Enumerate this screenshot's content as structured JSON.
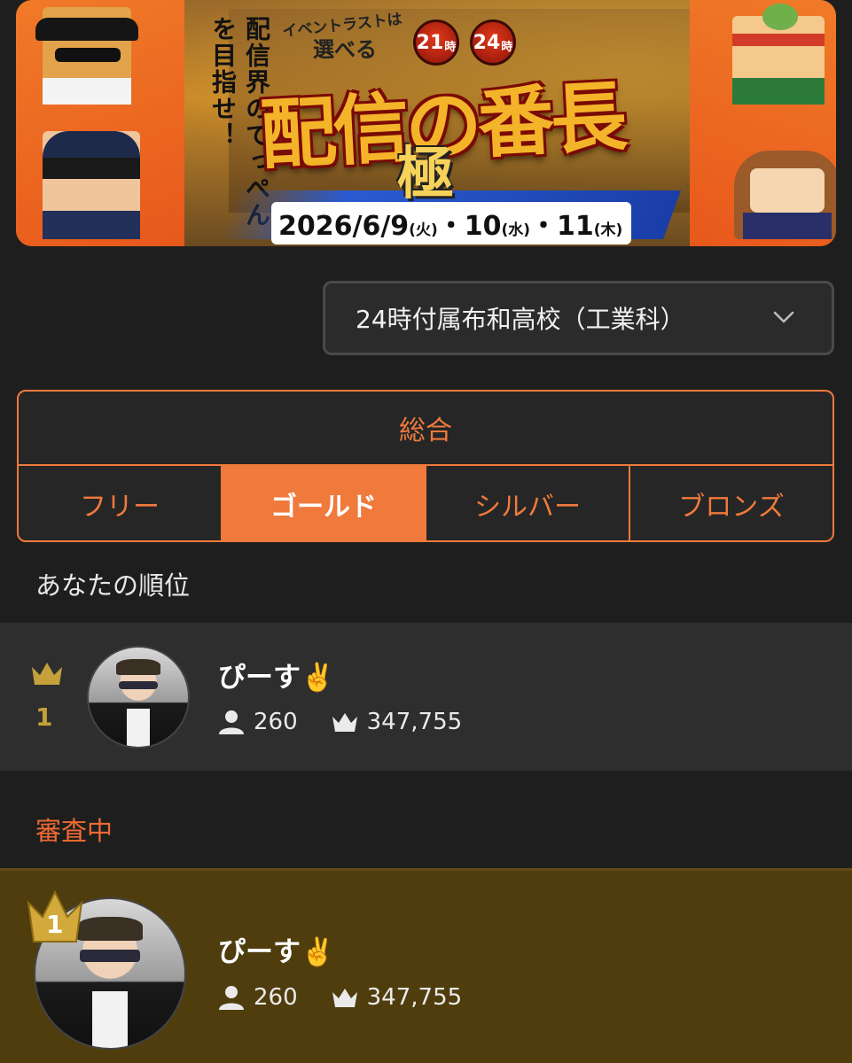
{
  "banner": {
    "tagline": "配信界のてっぺんを目指せ！",
    "pretitle": "イベントラストは",
    "choose": "選べる",
    "hour_options": [
      "21",
      "24"
    ],
    "hour_suffix": "時",
    "title": "配信の番長",
    "subtitle": "極",
    "date_prefix": "2026/",
    "date_main": "6/9",
    "date_dow1": "(火)",
    "date_sep1": "・10",
    "date_dow2": "(水)",
    "date_sep2": "・11",
    "date_dow3": "(木)"
  },
  "school_select": {
    "value": "24時付属布和高校（工業科）",
    "icon": "chevron-down-icon"
  },
  "tabs": {
    "total": "総合",
    "items": [
      "フリー",
      "ゴールド",
      "シルバー",
      "ブロンズ"
    ],
    "active": "ゴールド"
  },
  "my_rank": {
    "section_label": "あなたの順位",
    "rank": "1",
    "name": "ぴーす✌️",
    "followers": "260",
    "points": "347,755"
  },
  "review": {
    "section_label": "審査中",
    "rank": "1",
    "name": "ぴーす✌️",
    "followers": "260",
    "points": "347,755"
  },
  "colors": {
    "accent": "#ef7a3c",
    "background": "#1e1e1e",
    "gold": "#c4a13a",
    "highlight_row": "#4f3d0e"
  }
}
